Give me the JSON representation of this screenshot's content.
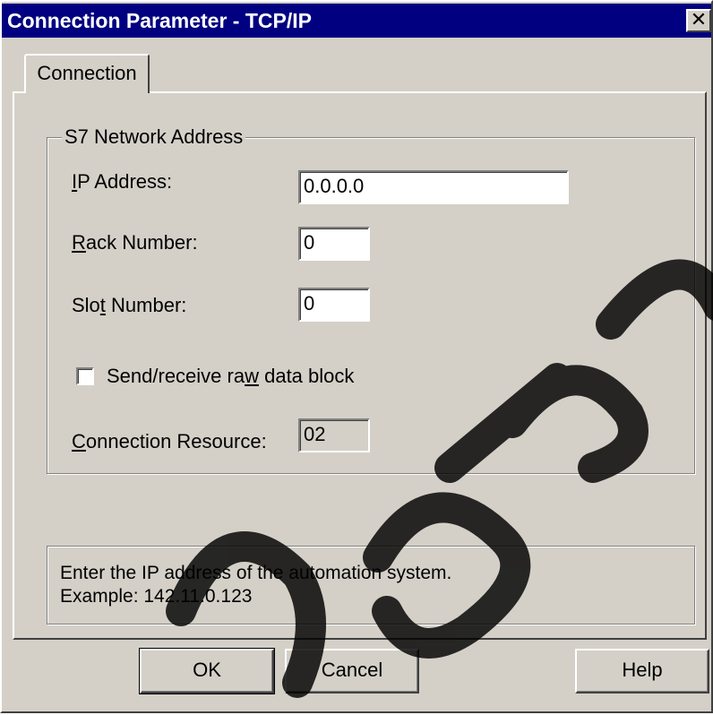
{
  "window": {
    "title": "Connection Parameter - TCP/IP",
    "close_glyph": "✕"
  },
  "tabs": [
    {
      "label": "Connection",
      "selected": true
    }
  ],
  "group": {
    "legend": "S7 Network Address",
    "ip": {
      "label_pre": "",
      "label_key": "I",
      "label_post": "P Address:",
      "value": "0.0.0.0"
    },
    "rack": {
      "label_pre": "",
      "label_key": "R",
      "label_post": "ack Number:",
      "value": "0"
    },
    "slot": {
      "label_pre": "Slo",
      "label_key": "t",
      "label_post": " Number:",
      "value": "0"
    },
    "raw": {
      "label_pre": "Send/receive ra",
      "label_key": "w",
      "label_post": " data block",
      "checked": false
    },
    "resource": {
      "label_pre": "",
      "label_key": "C",
      "label_post": "onnection Resource:",
      "value": "02"
    }
  },
  "info": {
    "line1": "Enter the IP address of the automation system.",
    "line2": "Example: 142.11.0.123"
  },
  "buttons": {
    "ok": "OK",
    "cancel": "Cancel",
    "help": "Help"
  },
  "colors": {
    "titlebar": "#000080",
    "face": "#d4d0c8"
  }
}
